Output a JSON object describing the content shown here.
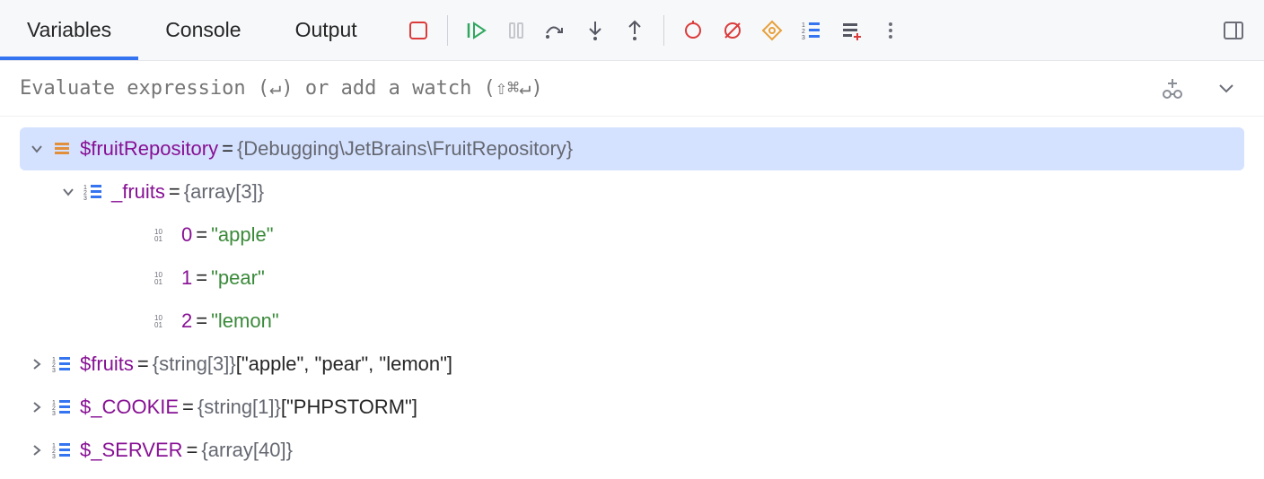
{
  "tabs": {
    "variables": "Variables",
    "console": "Console",
    "output": "Output"
  },
  "eval": {
    "placeholder": "Evaluate expression (↵) or add a watch (⇧⌘↵)"
  },
  "tree": {
    "root": {
      "name": "$fruitRepository",
      "eq": "=",
      "type": "{Debugging\\JetBrains\\FruitRepository}"
    },
    "fruitsField": {
      "name": "_fruits",
      "eq": "=",
      "type": "{array[3]}"
    },
    "items": [
      {
        "key": "0",
        "eq": "=",
        "value": "\"apple\""
      },
      {
        "key": "1",
        "eq": "=",
        "value": "\"pear\""
      },
      {
        "key": "2",
        "eq": "=",
        "value": "\"lemon\""
      }
    ],
    "fruitsVar": {
      "name": "$fruits",
      "eq": "=",
      "type": "{string[3]}",
      "summary": " [\"apple\", \"pear\", \"lemon\"]"
    },
    "cookie": {
      "name": "$_COOKIE",
      "eq": "=",
      "type": "{string[1]}",
      "summary": " [\"PHPSTORM\"]"
    },
    "server": {
      "name": "$_SERVER",
      "eq": "=",
      "type": "{array[40]}"
    }
  }
}
